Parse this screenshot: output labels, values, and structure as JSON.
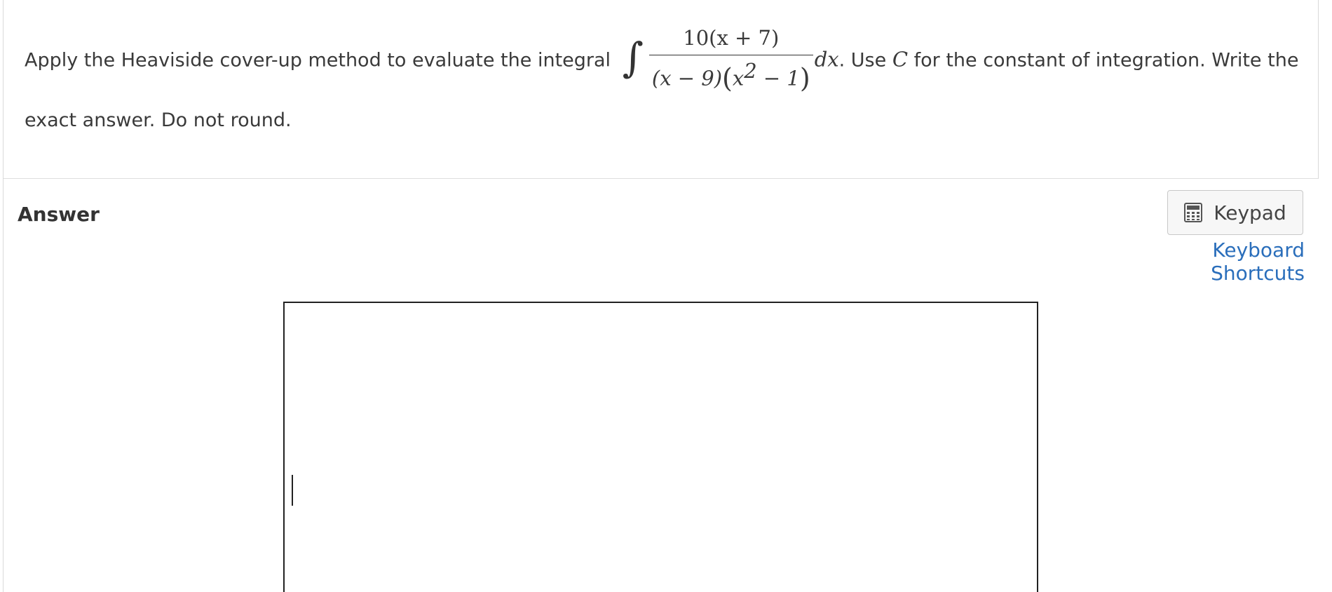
{
  "question": {
    "prefix": "Apply the Heaviside cover-up method to evaluate the integral",
    "integral_sign": "∫",
    "numerator": "10(x + 7)",
    "denominator_part1": "(x − 9)",
    "denominator_open": "(",
    "denominator_part2": "x",
    "denominator_exp": "2",
    "denominator_part3": " − 1",
    "denominator_close": ")",
    "differential": "dx",
    "middle": ". Use ",
    "constant_symbol": "C",
    "suffix": " for the constant of integration. Write the exact answer. Do not round."
  },
  "answer": {
    "label": "Answer",
    "keypad_label": "Keypad",
    "keyboard_shortcuts_label": "Keyboard Shortcuts",
    "input_value": ""
  },
  "colors": {
    "link": "#2a6ebb",
    "text": "#333333",
    "border": "#222222"
  },
  "icons": {
    "keypad": "calculator-icon"
  }
}
